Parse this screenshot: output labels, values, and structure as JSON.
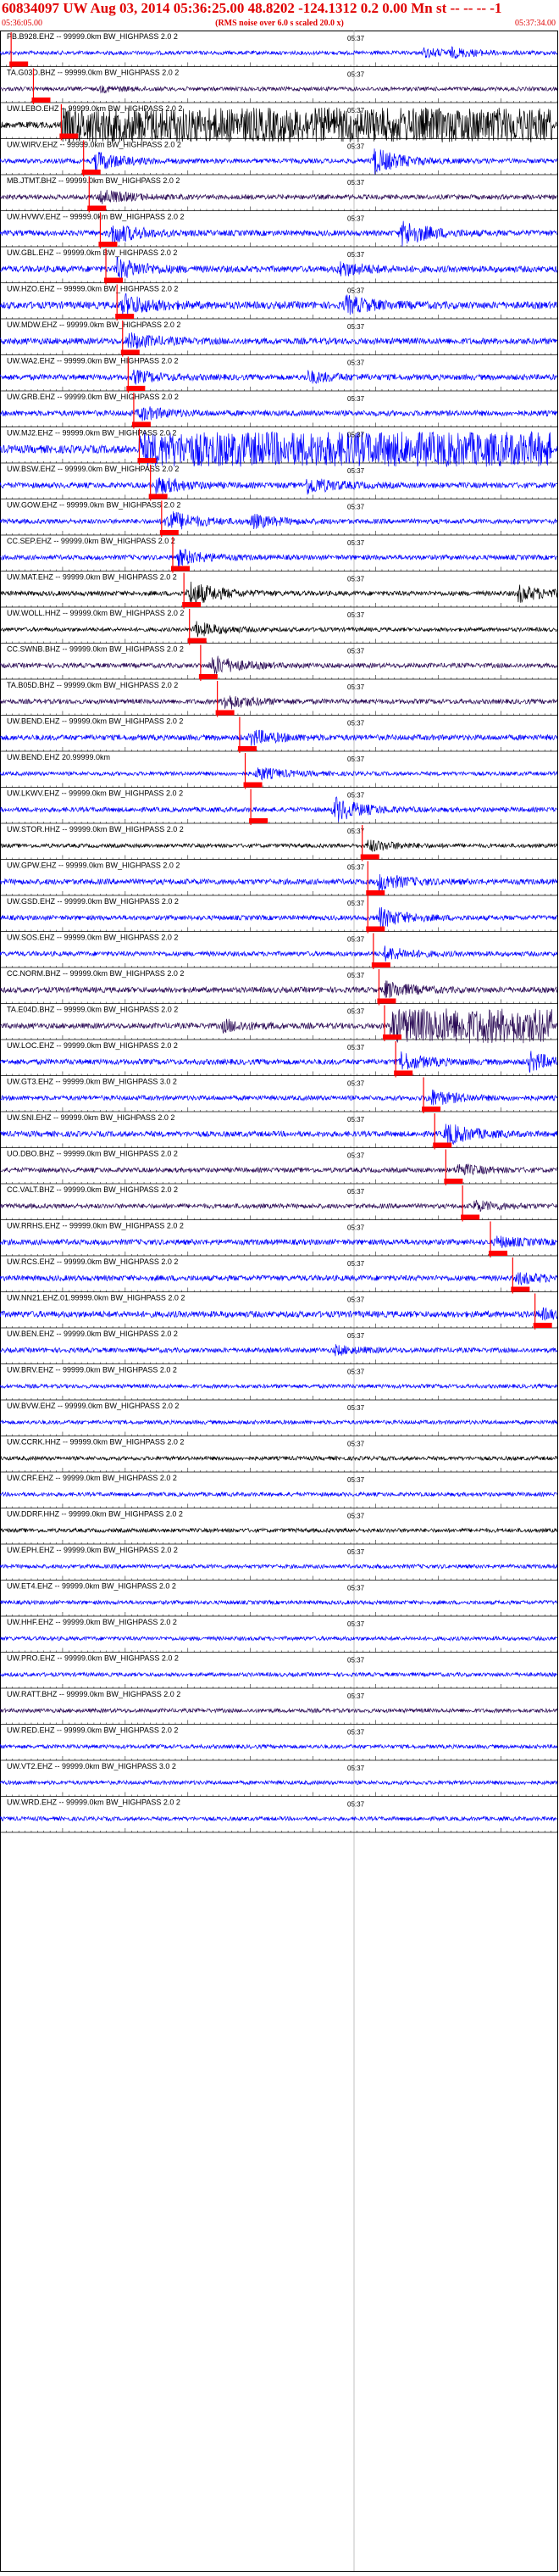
{
  "header": {
    "title": "60834097 UW Aug 03, 2014 05:36:25.00   48.8202 -124.1312  0.2 0.00 Mn st -- -- --  -1",
    "subtitle": "(RMS noise over 6.0 s scaled 20.0 x)",
    "start_time": "05:36:05.00",
    "end_time": "05:37:34.00"
  },
  "chart_data": {
    "type": "line",
    "title": "60834097 UW Aug 03, 2014 05:36:25.00   48.8202 -124.1312  0.2 0.00 Mn st -- -- --  -1",
    "subtitle": "(RMS noise over 6.0 s scaled 20.0 x)",
    "x_range": [
      "05:36:05.00",
      "05:37:34.00"
    ],
    "grid": true,
    "minute_tick_label": "05:37",
    "colors": {
      "blue": "#0000ff",
      "dark": "#2a0a55",
      "black": "#000000",
      "pick": "#ff0000"
    },
    "traces": [
      {
        "label": "PB.B928.EHZ -- 99999.0km BW_HIGHPASS  2.0  2",
        "color": "blue",
        "amp": 0.25,
        "pick": 0.02,
        "events": [
          [
            0.76,
            0.5
          ],
          [
            0.81,
            0.4
          ]
        ]
      },
      {
        "label": "TA.G03D.BHZ -- 99999.0km BW_HIGHPASS  2.0  2",
        "color": "dark",
        "amp": 0.25,
        "pick": 0.06,
        "events": [
          [
            0.18,
            0.3
          ]
        ]
      },
      {
        "label": "UW.LEBO.EHZ -- 99999.0km BW_HIGHPASS  2.0  2",
        "color": "black",
        "amp": 0.4,
        "pick": 0.11,
        "events": [],
        "saturate": [
          0.11,
          0.99
        ]
      },
      {
        "label": "UW.WIRV.EHZ -- 99999.0km BW_HIGHPASS  2.0  2",
        "color": "blue",
        "amp": 0.3,
        "pick": 0.15,
        "events": [
          [
            0.17,
            1.2
          ],
          [
            0.67,
            1.6
          ]
        ]
      },
      {
        "label": "MB.JTMT.BHZ -- 99999.0km BW_HIGHPASS  2.0  2",
        "color": "dark",
        "amp": 0.3,
        "pick": 0.16,
        "events": [
          [
            0.18,
            0.9
          ]
        ]
      },
      {
        "label": "UW.HVWV.EHZ -- 99999.0km BW_HIGHPASS  2.0  2",
        "color": "blue",
        "amp": 0.35,
        "pick": 0.18,
        "events": [
          [
            0.2,
            1.3
          ],
          [
            0.72,
            1.6
          ]
        ]
      },
      {
        "label": "UW.GBL.EHZ -- 99999.0km BW_HIGHPASS  2.0  2",
        "color": "blue",
        "amp": 0.4,
        "pick": 0.19,
        "events": [
          [
            0.21,
            1.2
          ],
          [
            0.61,
            0.8
          ]
        ]
      },
      {
        "label": "UW.HZO.EHZ -- 99999.0km BW_HIGHPASS  2.0  2",
        "color": "blue",
        "amp": 0.45,
        "pick": 0.21,
        "events": [
          [
            0.22,
            1.3
          ],
          [
            0.62,
            1.0
          ]
        ]
      },
      {
        "label": "UW.MDW.EHZ -- 99999.0km BW_HIGHPASS  2.0  2",
        "color": "blue",
        "amp": 0.4,
        "pick": 0.22,
        "events": [
          [
            0.23,
            0.9
          ]
        ]
      },
      {
        "label": "UW.WA2.EHZ -- 99999.0km BW_HIGHPASS  2.0  2",
        "color": "blue",
        "amp": 0.35,
        "pick": 0.23,
        "events": [
          [
            0.24,
            0.7
          ],
          [
            0.55,
            0.7
          ]
        ]
      },
      {
        "label": "UW.GRB.EHZ -- 99999.0km BW_HIGHPASS  2.0  2",
        "color": "blue",
        "amp": 0.35,
        "pick": 0.24,
        "events": [
          [
            0.25,
            0.8
          ]
        ]
      },
      {
        "label": "UW.MJ2.EHZ -- 99999.0km BW_HIGHPASS  2.0  2",
        "color": "blue",
        "amp": 0.5,
        "pick": 0.25,
        "events": [],
        "saturate": [
          0.25,
          0.99
        ]
      },
      {
        "label": "UW.BSW.EHZ -- 99999.0km BW_HIGHPASS  2.0  2",
        "color": "blue",
        "amp": 0.35,
        "pick": 0.27,
        "events": [
          [
            0.28,
            1.0
          ],
          [
            0.55,
            1.0
          ]
        ]
      },
      {
        "label": "UW.GOW.EHZ -- 99999.0km BW_HIGHPASS  2.0  2",
        "color": "blue",
        "amp": 0.3,
        "pick": 0.29,
        "events": [
          [
            0.3,
            1.4
          ],
          [
            0.45,
            0.8
          ]
        ]
      },
      {
        "label": "CC.SEP.EHZ -- 99999.0km BW_HIGHPASS  2.0  2",
        "color": "blue",
        "amp": 0.3,
        "pick": 0.31,
        "events": [
          [
            0.32,
            1.0
          ]
        ]
      },
      {
        "label": "UW.MAT.EHZ -- 99999.0km BW_HIGHPASS  2.0  2",
        "color": "black",
        "amp": 0.3,
        "pick": 0.33,
        "events": [
          [
            0.34,
            1.6
          ],
          [
            0.93,
            1.0
          ]
        ]
      },
      {
        "label": "UW.WOLL.HHZ -- 99999.0km BW_HIGHPASS  2.0  2",
        "color": "black",
        "amp": 0.25,
        "pick": 0.34,
        "events": [
          [
            0.35,
            0.9
          ]
        ]
      },
      {
        "label": "CC.SWNB.BHZ -- 99999.0km BW_HIGHPASS  2.0  2",
        "color": "dark",
        "amp": 0.3,
        "pick": 0.36,
        "events": [
          [
            0.38,
            1.2
          ]
        ]
      },
      {
        "label": "TA.B05D.BHZ -- 99999.0km BW_HIGHPASS  2.0  2",
        "color": "dark",
        "amp": 0.3,
        "pick": 0.39,
        "events": [
          [
            0.4,
            1.0
          ]
        ]
      },
      {
        "label": "UW.BEND.EHZ -- 99999.0km BW_HIGHPASS  2.0  2",
        "color": "blue",
        "amp": 0.35,
        "pick": 0.43,
        "events": [
          [
            0.45,
            0.9
          ]
        ]
      },
      {
        "label": "UW.BEND.EHZ 20.99999.0km",
        "color": "blue",
        "amp": 0.25,
        "pick": 0.44,
        "events": [
          [
            0.46,
            0.8
          ]
        ]
      },
      {
        "label": "UW.LKWV.EHZ -- 99999.0km BW_HIGHPASS  2.0  2",
        "color": "blue",
        "amp": 0.3,
        "pick": 0.45,
        "events": [
          [
            0.6,
            1.5
          ]
        ]
      },
      {
        "label": "UW.STOR.HHZ -- 99999.0km BW_HIGHPASS  2.0  2",
        "color": "black",
        "amp": 0.25,
        "pick": 0.65,
        "events": [
          [
            0.66,
            0.7
          ]
        ]
      },
      {
        "label": "UW.GPW.EHZ -- 99999.0km BW_HIGHPASS  2.0  2",
        "color": "blue",
        "amp": 0.35,
        "pick": 0.66,
        "events": [
          [
            0.68,
            1.0
          ]
        ]
      },
      {
        "label": "UW.GSD.EHZ -- 99999.0km BW_HIGHPASS  2.0  2",
        "color": "blue",
        "amp": 0.3,
        "pick": 0.66,
        "events": [
          [
            0.68,
            1.2
          ]
        ]
      },
      {
        "label": "UW.SOS.EHZ -- 99999.0km BW_HIGHPASS  2.0  2",
        "color": "blue",
        "amp": 0.3,
        "pick": 0.67,
        "events": [
          [
            0.69,
            0.8
          ]
        ]
      },
      {
        "label": "CC.NORM.BHZ -- 99999.0km BW_HIGHPASS  2.0  2",
        "color": "dark",
        "amp": 0.35,
        "pick": 0.68,
        "events": [
          [
            0.69,
            1.0
          ]
        ]
      },
      {
        "label": "TA.E04D.BHZ -- 99999.0km BW_HIGHPASS  2.0  2",
        "color": "dark",
        "amp": 0.35,
        "pick": 0.69,
        "events": [
          [
            0.4,
            0.7
          ]
        ],
        "saturate": [
          0.7,
          0.99
        ]
      },
      {
        "label": "UW.LOC.EHZ -- 99999.0km BW_HIGHPASS  2.0  2",
        "color": "blue",
        "amp": 0.35,
        "pick": 0.71,
        "events": [
          [
            0.72,
            1.0
          ],
          [
            0.95,
            1.1
          ]
        ]
      },
      {
        "label": "UW.GT3.EHZ -- 99999.0km BW_HIGHPASS  3.0  2",
        "color": "blue",
        "amp": 0.3,
        "pick": 0.76,
        "events": [
          [
            0.77,
            1.0
          ]
        ]
      },
      {
        "label": "UW.SNI.EHZ -- 99999.0km BW_HIGHPASS  2.0  2",
        "color": "blue",
        "amp": 0.35,
        "pick": 0.78,
        "events": [
          [
            0.8,
            1.3
          ]
        ]
      },
      {
        "label": "UO.DBO.BHZ -- 99999.0km BW_HIGHPASS  2.0  2",
        "color": "dark",
        "amp": 0.3,
        "pick": 0.8,
        "events": [
          [
            0.82,
            0.7
          ]
        ]
      },
      {
        "label": "CC.VALT.BHZ -- 99999.0km BW_HIGHPASS  2.0  2",
        "color": "dark",
        "amp": 0.3,
        "pick": 0.83,
        "events": [
          [
            0.85,
            0.6
          ]
        ]
      },
      {
        "label": "UW.RRHS.EHZ -- 99999.0km BW_HIGHPASS  2.0  2",
        "color": "blue",
        "amp": 0.35,
        "pick": 0.88,
        "events": [
          [
            0.89,
            0.6
          ]
        ]
      },
      {
        "label": "UW.RCS.EHZ -- 99999.0km BW_HIGHPASS  2.0  2",
        "color": "blue",
        "amp": 0.35,
        "pick": 0.92,
        "events": [
          [
            0.93,
            0.6
          ]
        ]
      },
      {
        "label": "UW.NN21.EHZ.01.99999.0km BW_HIGHPASS  2.0  2",
        "color": "blue",
        "amp": 0.4,
        "pick": 0.96,
        "events": [
          [
            0.97,
            0.5
          ]
        ]
      },
      {
        "label": "UW.BEN.EHZ -- 99999.0km BW_HIGHPASS  2.0  2",
        "color": "blue",
        "amp": 0.3,
        "pick": null,
        "events": [
          [
            0.6,
            0.5
          ]
        ]
      },
      {
        "label": "UW.BRV.EHZ -- 99999.0km BW_HIGHPASS  2.0  2",
        "color": "blue",
        "amp": 0.25,
        "pick": null,
        "events": []
      },
      {
        "label": "UW.BVW.EHZ -- 99999.0km BW_HIGHPASS  2.0  2",
        "color": "blue",
        "amp": 0.25,
        "pick": null,
        "events": []
      },
      {
        "label": "UW.CCRK.HHZ -- 99999.0km BW_HIGHPASS  2.0  2",
        "color": "black",
        "amp": 0.25,
        "pick": null,
        "events": []
      },
      {
        "label": "UW.CRF.EHZ -- 99999.0km BW_HIGHPASS  2.0  2",
        "color": "blue",
        "amp": 0.25,
        "pick": null,
        "events": []
      },
      {
        "label": "UW.DDRF.HHZ -- 99999.0km BW_HIGHPASS  2.0  2",
        "color": "black",
        "amp": 0.25,
        "pick": null,
        "events": []
      },
      {
        "label": "UW.EPH.EHZ -- 99999.0km BW_HIGHPASS  2.0  2",
        "color": "blue",
        "amp": 0.25,
        "pick": null,
        "events": []
      },
      {
        "label": "UW.ET4.EHZ -- 99999.0km BW_HIGHPASS  2.0  2",
        "color": "blue",
        "amp": 0.25,
        "pick": null,
        "events": []
      },
      {
        "label": "UW.HHF.EHZ -- 99999.0km BW_HIGHPASS  2.0  2",
        "color": "blue",
        "amp": 0.25,
        "pick": null,
        "events": []
      },
      {
        "label": "UW.PRO.EHZ -- 99999.0km BW_HIGHPASS  2.0  2",
        "color": "blue",
        "amp": 0.25,
        "pick": null,
        "events": []
      },
      {
        "label": "UW.RATT.BHZ -- 99999.0km BW_HIGHPASS  2.0  2",
        "color": "dark",
        "amp": 0.25,
        "pick": null,
        "events": []
      },
      {
        "label": "UW.RED.EHZ -- 99999.0km BW_HIGHPASS  2.0  2",
        "color": "blue",
        "amp": 0.25,
        "pick": null,
        "events": []
      },
      {
        "label": "UW.VT2.EHZ -- 99999.0km BW_HIGHPASS  3.0  2",
        "color": "blue",
        "amp": 0.25,
        "pick": null,
        "events": []
      },
      {
        "label": "UW.WRD.EHZ -- 99999.0km BW_HIGHPASS  2.0  2",
        "color": "blue",
        "amp": 0.25,
        "pick": null,
        "events": []
      }
    ]
  }
}
